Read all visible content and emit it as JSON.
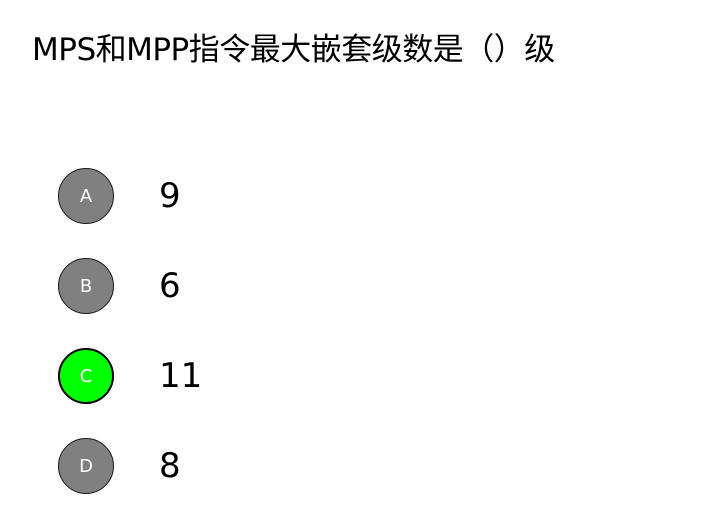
{
  "question": {
    "text": "MPS和MPP指令最大嵌套级数是（）级"
  },
  "options": [
    {
      "letter": "A",
      "text": "9",
      "selected": false
    },
    {
      "letter": "B",
      "text": "6",
      "selected": false
    },
    {
      "letter": "C",
      "text": "11",
      "selected": true
    },
    {
      "letter": "D",
      "text": "8",
      "selected": false
    }
  ],
  "colors": {
    "badge_default": "#808080",
    "badge_selected": "#00ff00",
    "badge_border": "#000000",
    "badge_text": "#ffffff",
    "text": "#000000",
    "background": "#ffffff"
  }
}
